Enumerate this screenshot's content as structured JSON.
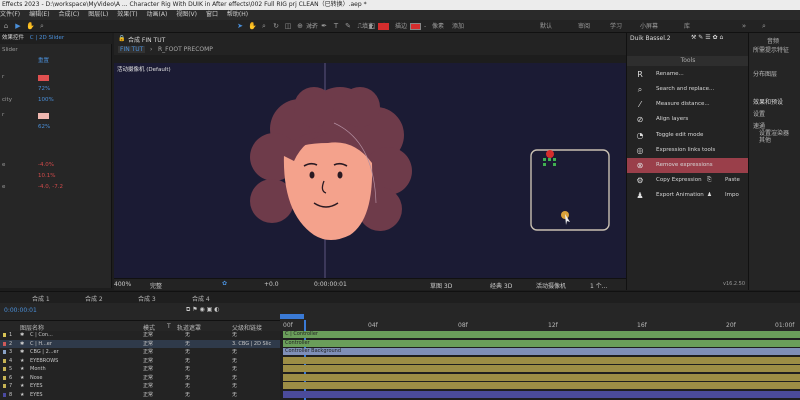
{
  "title_bar": "Effects 2023 - D:\\workspace\\MyVideo\\A ... Character Rig With DUIK in After effects\\002 Full RIG prj CLEAN（已转换）.aep *",
  "menu": [
    "文件(F)",
    "编辑(E)",
    "合成(C)",
    "图层(L)",
    "效果(T)",
    "动画(A)",
    "视图(V)",
    "窗口",
    "帮助(H)"
  ],
  "toolbar": {
    "snap": "对齐",
    "fill": "填充",
    "stroke": "描边",
    "stroke_val": "-",
    "add_label": "添加",
    "ws_text": "像素",
    "workspaces": [
      "默认",
      "审阅",
      "学习",
      "小屏幕",
      "库"
    ],
    "colors": {
      "fill": "#d42d2d",
      "stroke": "#d42d2d"
    }
  },
  "left_panel": {
    "title": "效果控件",
    "layer_name": "C | 2D Slider",
    "rows": [
      {
        "label": "Slider",
        "value": ""
      },
      {
        "label": "",
        "value": "重置"
      },
      {
        "label": "r",
        "value": "",
        "swatch": "#e05050"
      },
      {
        "label": "",
        "value": "72%"
      },
      {
        "label": "city",
        "value": "100%"
      },
      {
        "label": "r",
        "value": "",
        "swatch": "#f0b8b0"
      },
      {
        "label": "",
        "value": "62%"
      },
      {
        "label": "e",
        "value": "-4.0%"
      },
      {
        "label": "",
        "value": "10.1%"
      },
      {
        "label": "e",
        "value": "-4.0, -7.2"
      }
    ]
  },
  "comp": {
    "tabs": [
      "合成 FIN TUT"
    ],
    "breadcrumb": [
      "FIN TUT",
      "R_FOOT PRECOMP"
    ],
    "camera_label": "活动摄像机 (Default)"
  },
  "viewer_footer": {
    "zoom": "400%",
    "quality": "完整",
    "exposure": "+0.0",
    "timecode": "0:00:00:01",
    "draft3d": "草图 3D",
    "renderer": "经典 3D",
    "camera": "活动摄像机",
    "views": "1 个..."
  },
  "duik": {
    "title": "Duik Bassel.2",
    "section": "Tools",
    "items": [
      {
        "icon": "rename-icon",
        "glyph": "R",
        "label": "Rename..."
      },
      {
        "icon": "search-icon",
        "glyph": "⌕",
        "label": "Search and replace..."
      },
      {
        "icon": "ruler-icon",
        "glyph": "⁄",
        "label": "Measure distance..."
      },
      {
        "icon": "align-icon",
        "glyph": "⊘",
        "label": "Align layers"
      },
      {
        "icon": "edit-mode-icon",
        "glyph": "◔",
        "label": "Toggle edit mode"
      },
      {
        "icon": "expression-link-icon",
        "glyph": "◎",
        "label": "Expression links tools"
      },
      {
        "icon": "remove-expression-icon",
        "glyph": "⊗",
        "label": "Remove expressions"
      },
      {
        "icon": "copy-expression-icon",
        "glyph": "⚙",
        "label": "Copy Expression"
      },
      {
        "icon": "export-animation-icon",
        "glyph": "♟",
        "label": "Export Animation"
      }
    ],
    "paste_label": "Paste",
    "import_label": "Impo",
    "version": "v16.2.50"
  },
  "right_panel": {
    "items": [
      "音频",
      "所需提示特征",
      "分布图层",
      "效果和预设",
      "设置",
      "速通",
      "设置渲染器",
      "其他"
    ]
  },
  "timeline": {
    "tabs": [
      "合成 1",
      "合成 2",
      "合成 3",
      "合成 4"
    ],
    "timecode": "0:00:00:01",
    "columns": [
      "图层名称",
      "模式",
      "T",
      "轨道遮罩",
      "父级和链接"
    ],
    "ruler": [
      "00f",
      "04f",
      "08f",
      "12f",
      "16f",
      "20f",
      "01:00f"
    ],
    "layers": [
      {
        "num": "1",
        "name": "C | Con...",
        "mode": "正常",
        "matte": "无",
        "parent": "无",
        "color": "#d7c354",
        "bar": "#6a9e5a",
        "bar_text": "C | Controller"
      },
      {
        "num": "2",
        "name": "C | H...er",
        "mode": "正常",
        "matte": "无",
        "parent": "3. CBG | 2D Slic",
        "color": "#ce5a5a",
        "bar": "#6a9e5a",
        "bar_text": "Controller"
      },
      {
        "num": "3",
        "name": "CBG | 2...er",
        "mode": "正常",
        "matte": "无",
        "parent": "无",
        "color": "#8aa3c6",
        "bar": "#7f8fb8",
        "bar_text": "Controller Background"
      },
      {
        "num": "4",
        "name": "EYEBROWS",
        "mode": "正常",
        "matte": "无",
        "parent": "无",
        "color": "#c6b354",
        "bar": "#9c8d45",
        "bar_text": ""
      },
      {
        "num": "5",
        "name": "Month",
        "mode": "正常",
        "matte": "无",
        "parent": "无",
        "color": "#c6b354",
        "bar": "#9c8d45",
        "bar_text": ""
      },
      {
        "num": "6",
        "name": "Nose",
        "mode": "正常",
        "matte": "无",
        "parent": "无",
        "color": "#c6b354",
        "bar": "#9c8d45",
        "bar_text": ""
      },
      {
        "num": "7",
        "name": "EYES",
        "mode": "正常",
        "matte": "无",
        "parent": "无",
        "color": "#c6b354",
        "bar": "#9c8d45",
        "bar_text": ""
      },
      {
        "num": "8",
        "name": "EYES",
        "mode": "正常",
        "matte": "无",
        "parent": "无",
        "color": "#4a4aa0",
        "bar": "#4b4b9a",
        "bar_text": ""
      }
    ]
  }
}
